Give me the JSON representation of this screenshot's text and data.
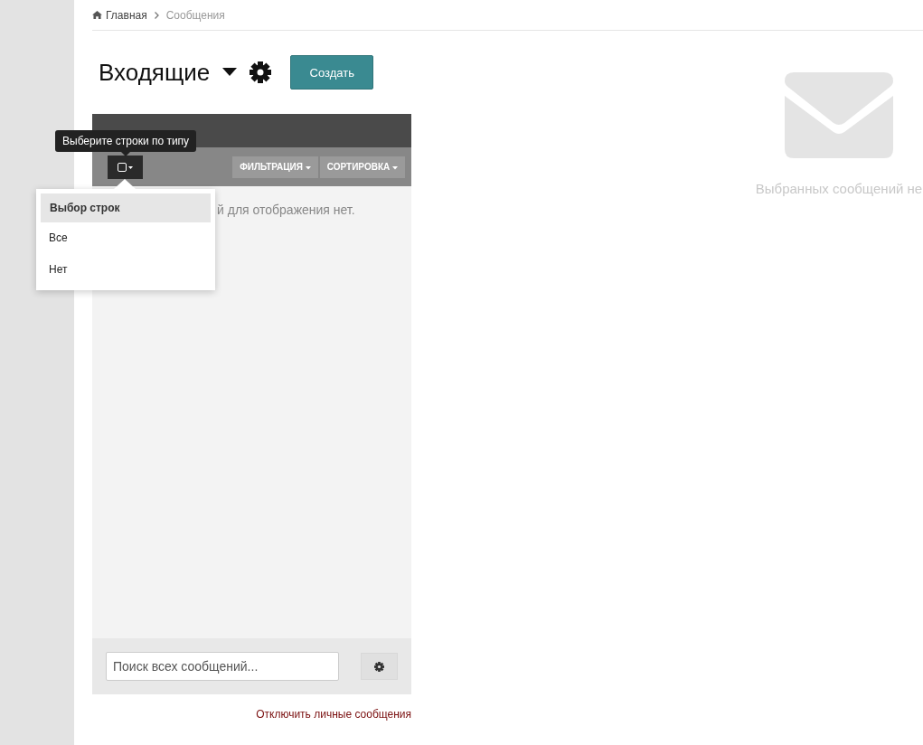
{
  "breadcrumb": [
    {
      "label": "Главная",
      "kind": "home"
    },
    {
      "label": "Сообщения",
      "kind": "current"
    }
  ],
  "title": "Входящие",
  "create_button": "Создать",
  "toolbar": {
    "filter": "ФИЛЬТРАЦИЯ",
    "sort": "СОРТИРОВКА"
  },
  "empty_text": "й для отображения нет.",
  "tooltip": "Выберите строки по типу",
  "dropdown": {
    "header": "Выбор строк",
    "items": [
      {
        "label": "Все"
      },
      {
        "label": "Нет"
      }
    ]
  },
  "search": {
    "placeholder": "Поиск всех сообщений..."
  },
  "disable_link": "Отключить личные сообщения",
  "preview_empty": "Выбранных сообщений не"
}
